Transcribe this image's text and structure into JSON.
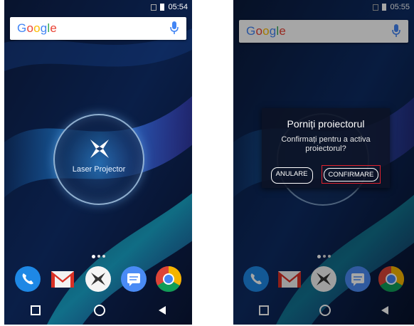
{
  "colors": {
    "google_blue": "#4285F4",
    "google_red": "#EA4335",
    "google_yellow": "#FBBC05",
    "google_green": "#34A853",
    "highlight_red": "#e2222e",
    "dialog_bg": "#0c1224"
  },
  "screens": [
    {
      "status_time": "05:54",
      "search": {
        "logo_letters": [
          "G",
          "o",
          "o",
          "g",
          "l",
          "e"
        ],
        "mic_icon": "mic-icon"
      },
      "widget": {
        "label": "Laser Projector",
        "icon": "projector-star-icon"
      },
      "dock_icons": [
        "phone-icon",
        "gmail-icon",
        "laser-projector-icon",
        "messages-icon",
        "chrome-icon"
      ]
    },
    {
      "status_time": "05:55",
      "search": {
        "logo_letters": [
          "G",
          "o",
          "o",
          "g",
          "l",
          "e"
        ],
        "mic_icon": "mic-icon"
      },
      "dialog": {
        "title": "Porniți proiectorul",
        "message": "Confirmați pentru a activa proiectorul?",
        "cancel_label": "ANULARE",
        "confirm_label": "CONFIRMARE"
      },
      "dock_icons": [
        "phone-icon",
        "gmail-icon",
        "laser-projector-icon",
        "messages-icon",
        "chrome-icon"
      ]
    }
  ]
}
